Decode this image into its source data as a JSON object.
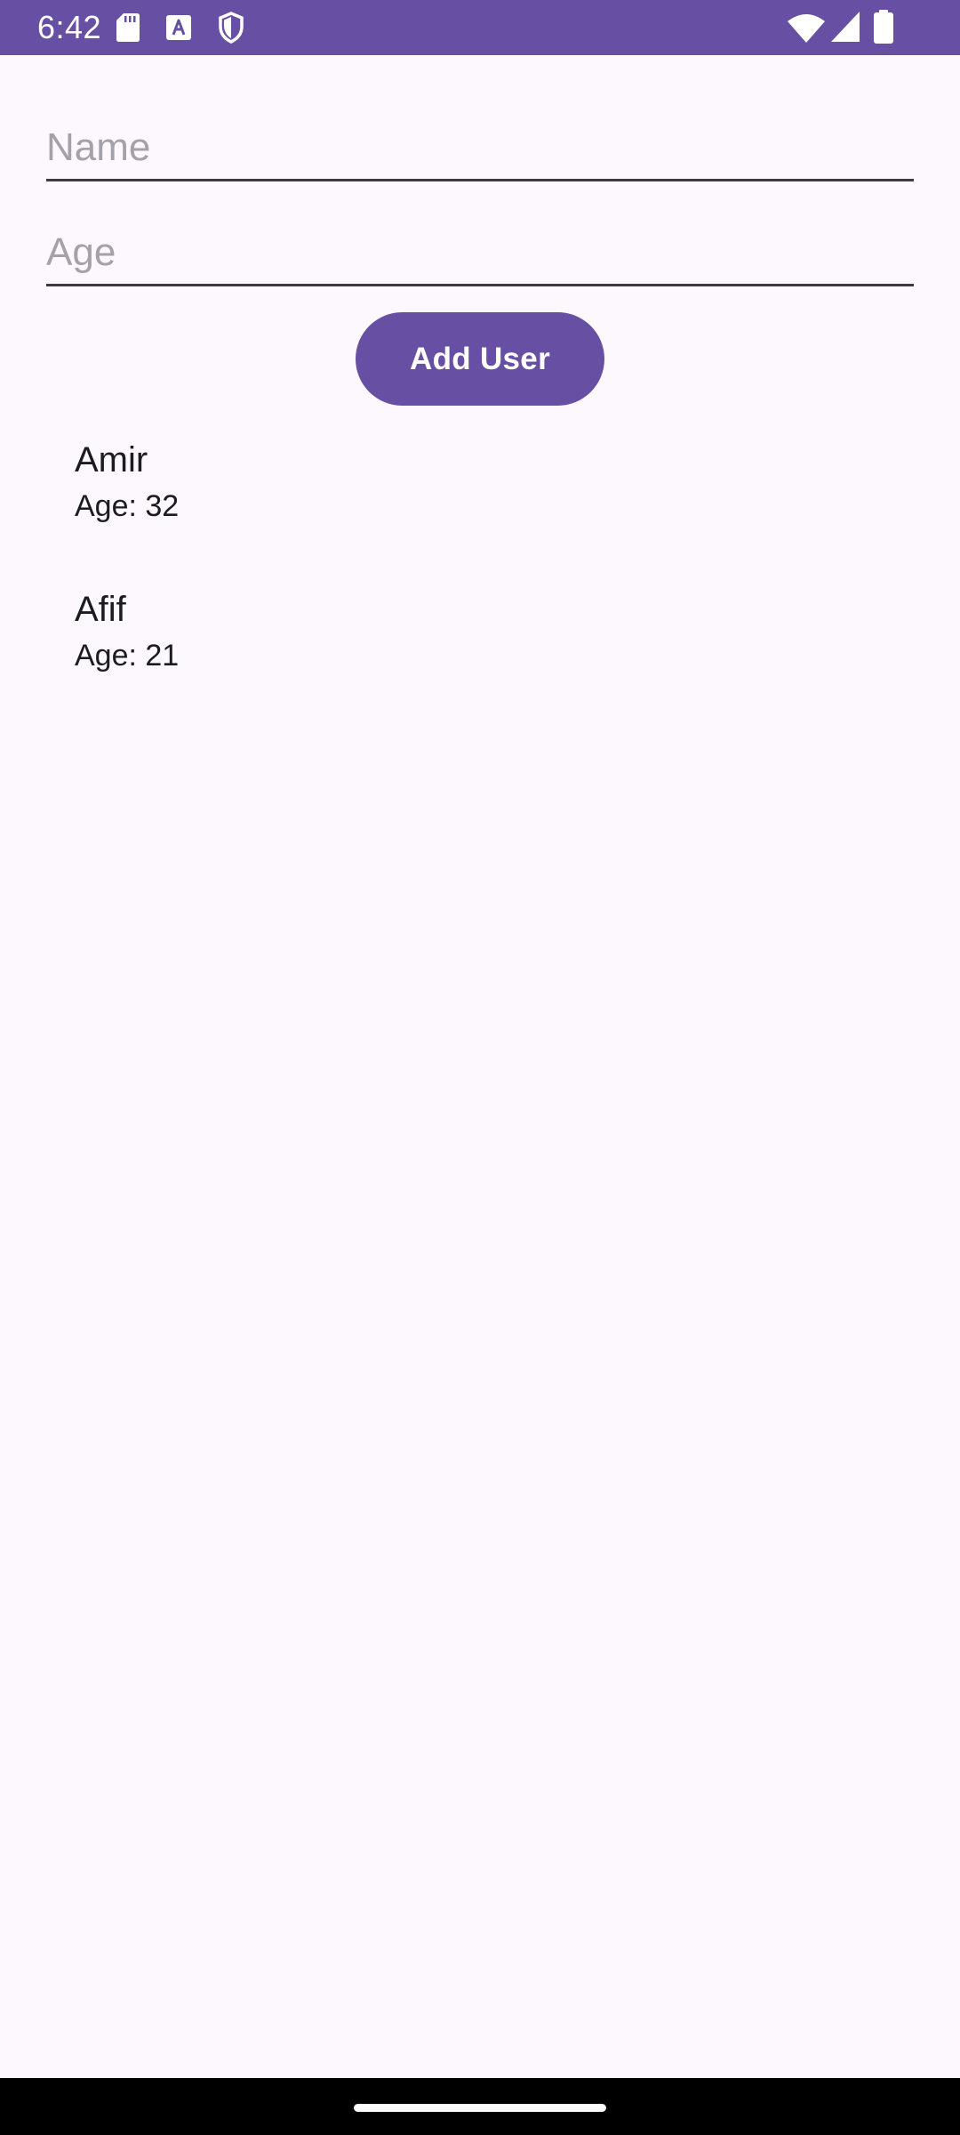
{
  "status_bar": {
    "time": "6:42",
    "icons": [
      "sd-card-icon",
      "text-a-icon",
      "shield-icon",
      "wifi-icon",
      "signal-icon",
      "battery-icon"
    ]
  },
  "form": {
    "name_placeholder": "Name",
    "name_value": "",
    "age_placeholder": "Age",
    "age_value": "",
    "add_button_label": "Add User"
  },
  "users": [
    {
      "name": "Amir",
      "age": "Age: 32"
    },
    {
      "name": "Afif",
      "age": "Age: 21"
    }
  ],
  "colors": {
    "primary": "#6750A4",
    "background": "#FDF7FE",
    "text": "#1C1B1F",
    "placeholder": "#A5A1AA"
  }
}
